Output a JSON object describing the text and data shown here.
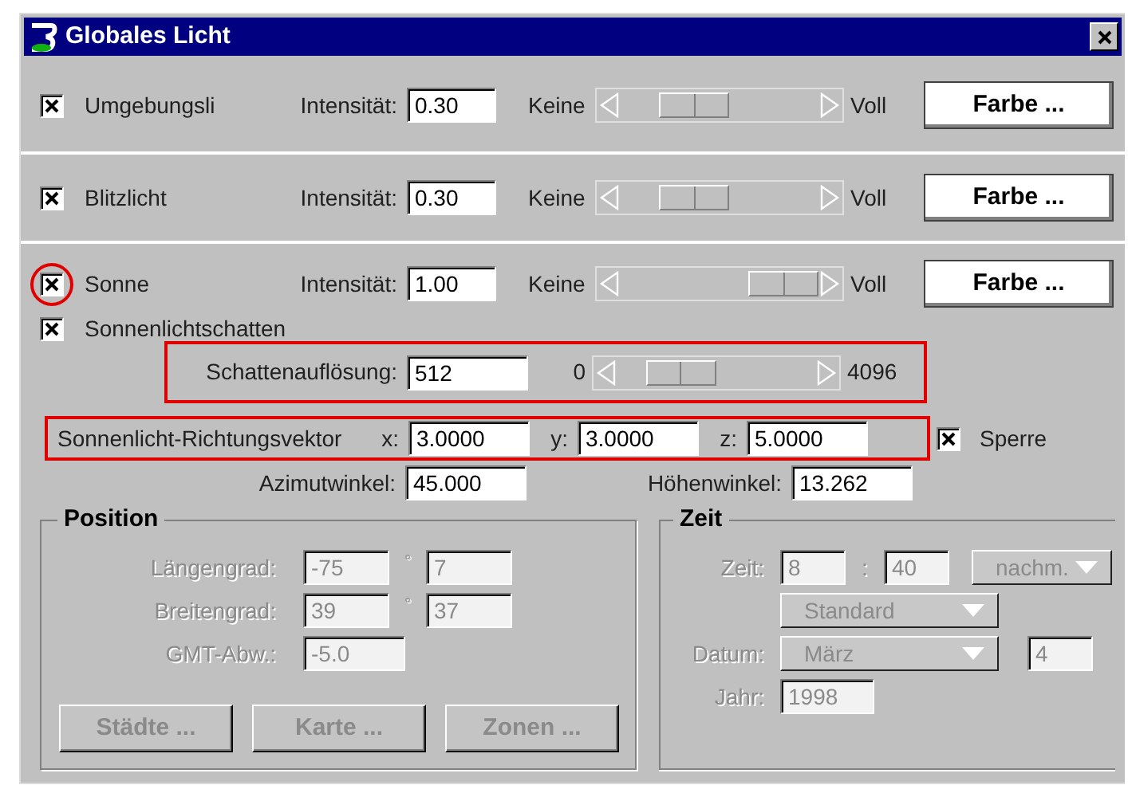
{
  "window": {
    "title": "Globales Licht"
  },
  "lights": [
    {
      "label": "Umgebungsli",
      "checked": true,
      "intensity_label": "Intensität:",
      "intensity": "0.30",
      "min_label": "Keine",
      "max_label": "Voll",
      "level": 0.3,
      "button": "Farbe ...",
      "circled": false
    },
    {
      "label": "Blitzlicht",
      "checked": true,
      "intensity_label": "Intensität:",
      "intensity": "0.30",
      "min_label": "Keine",
      "max_label": "Voll",
      "level": 0.3,
      "button": "Farbe ...",
      "circled": false
    },
    {
      "label": "Sonne",
      "checked": true,
      "intensity_label": "Intensität:",
      "intensity": "1.00",
      "min_label": "Keine",
      "max_label": "Voll",
      "button": "Farbe ...",
      "circled": true
    }
  ],
  "shadow": {
    "label": "Sonnenlichtschatten",
    "checked": true
  },
  "resolution": {
    "label": "Schattenauflösung:",
    "value": "512",
    "min_label": "0",
    "max_label": "4096",
    "highlighted": true
  },
  "vector": {
    "label": "Sonnenlicht-Richtungsvektor",
    "highlighted": true,
    "fields": [
      {
        "label": "x:",
        "value": "3.0000"
      },
      {
        "label": "y:",
        "value": "3.0000"
      },
      {
        "label": "z:",
        "value": "5.0000"
      }
    ]
  },
  "lock": {
    "label": "Sperre",
    "checked": true
  },
  "angles": [
    {
      "label": "Azimutwinkel:",
      "value": "45.000"
    },
    {
      "label": "Höhenwinkel:",
      "value": "13.262"
    }
  ],
  "position": {
    "title": "Position",
    "disabled": true,
    "rows": [
      {
        "label": "Längengrad:",
        "degrees": "-75",
        "separator": "°",
        "minutes": "7"
      },
      {
        "label": "Breitengrad:",
        "degrees": "39",
        "separator": "°",
        "minutes": "37"
      }
    ],
    "gmt_label": "GMT-Abw.:",
    "gmt": "-5.0",
    "buttons": [
      "Städte ...",
      "Karte ...",
      "Zonen ..."
    ]
  },
  "time": {
    "title": "Zeit",
    "disabled": true,
    "time_label": "Zeit:",
    "hour": "8",
    "separator": ":",
    "minute": "40",
    "ampm": "nachm.",
    "zone": "Standard",
    "date_label": "Datum:",
    "month": "März",
    "day": "4",
    "year_label": "Jahr:",
    "year": "1998"
  }
}
